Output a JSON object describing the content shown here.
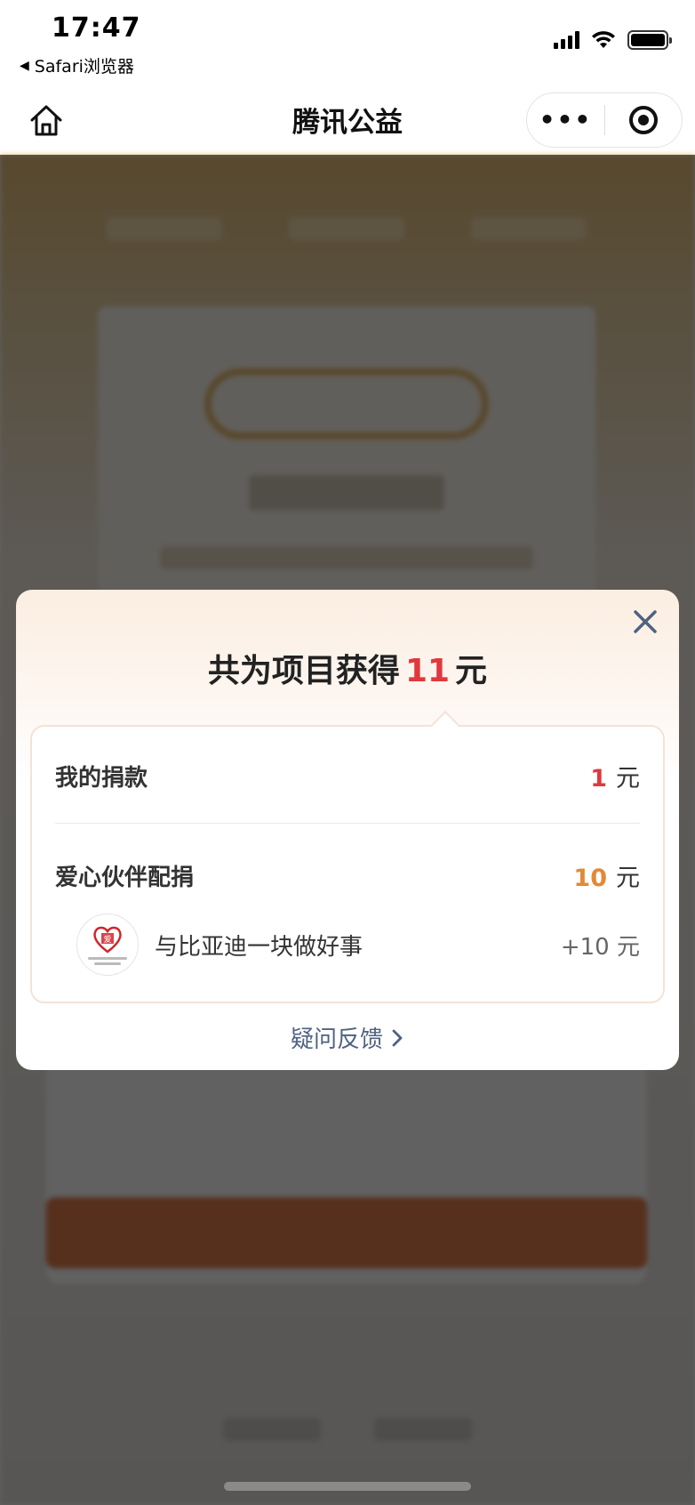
{
  "status_bar": {
    "time": "17:47",
    "back_app": "Safari浏览器",
    "back_arrow": "◀"
  },
  "nav": {
    "title": "腾讯公益",
    "home_icon": "home-icon",
    "more_label": "•••",
    "close_icon": "record-icon"
  },
  "popup": {
    "title_prefix": "共为项目获得",
    "title_amount": "11",
    "title_unit": "元",
    "my_donation": {
      "label": "我的捐款",
      "amount": "1",
      "unit": "元"
    },
    "partner_match": {
      "label": "爱心伙伴配捐",
      "amount": "10",
      "unit": "元"
    },
    "partners": [
      {
        "name": "与比亚迪一块做好事",
        "amount": "+10 元",
        "logo_text": "爱"
      }
    ],
    "feedback_label": "疑问反馈"
  },
  "colors": {
    "accent_red": "#e0383e",
    "accent_orange": "#e58835",
    "feedback_blue": "#4f6280"
  }
}
